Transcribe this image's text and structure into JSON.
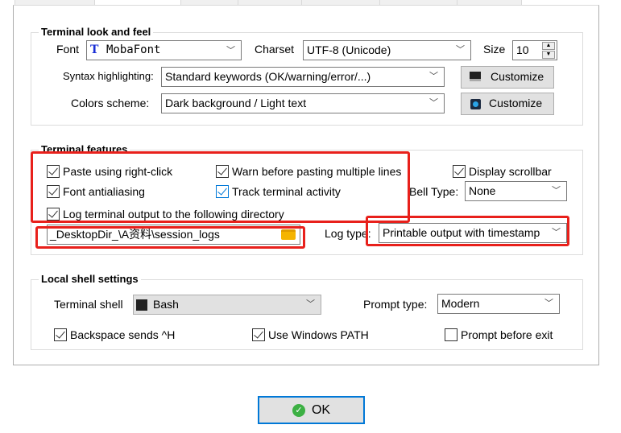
{
  "look": {
    "legend": "Terminal look and feel",
    "font_label": "Font",
    "font_value": "MobaFont",
    "charset_label": "Charset",
    "charset_value": "UTF-8 (Unicode)",
    "size_label": "Size",
    "size_value": "10",
    "syntax_label": "Syntax highlighting:",
    "syntax_value": "Standard keywords (OK/warning/error/...)",
    "colors_label": "Colors scheme:",
    "colors_value": "Dark background / Light text",
    "customize_label": "Customize"
  },
  "features": {
    "legend": "Terminal features",
    "checkboxes": [
      {
        "label": "Paste using right-click",
        "checked": true
      },
      {
        "label": "Warn before pasting multiple lines",
        "checked": true
      },
      {
        "label": "Display scrollbar",
        "checked": true
      },
      {
        "label": "Font antialiasing",
        "checked": true
      },
      {
        "label": "Track terminal activity",
        "checked": true
      },
      {
        "label": "Log terminal output to the following directory",
        "checked": true
      }
    ],
    "bell_label": "Bell Type:",
    "bell_value": "None",
    "log_dir": "_DesktopDir_\\A资料\\session_logs",
    "log_type_label": "Log type:",
    "log_type_value": "Printable output with timestamp"
  },
  "shell": {
    "legend": "Local shell settings",
    "shell_label": "Terminal shell",
    "shell_value": "Bash",
    "prompt_label": "Prompt type:",
    "prompt_value": "Modern",
    "checkboxes": [
      {
        "label": "Backspace sends ^H",
        "checked": true
      },
      {
        "label": "Use Windows PATH",
        "checked": true
      },
      {
        "label": "Prompt before exit",
        "checked": false
      }
    ]
  },
  "ok_label": "OK",
  "colors": {
    "highlight": "#e8201b",
    "ok_border": "#0078d7"
  }
}
